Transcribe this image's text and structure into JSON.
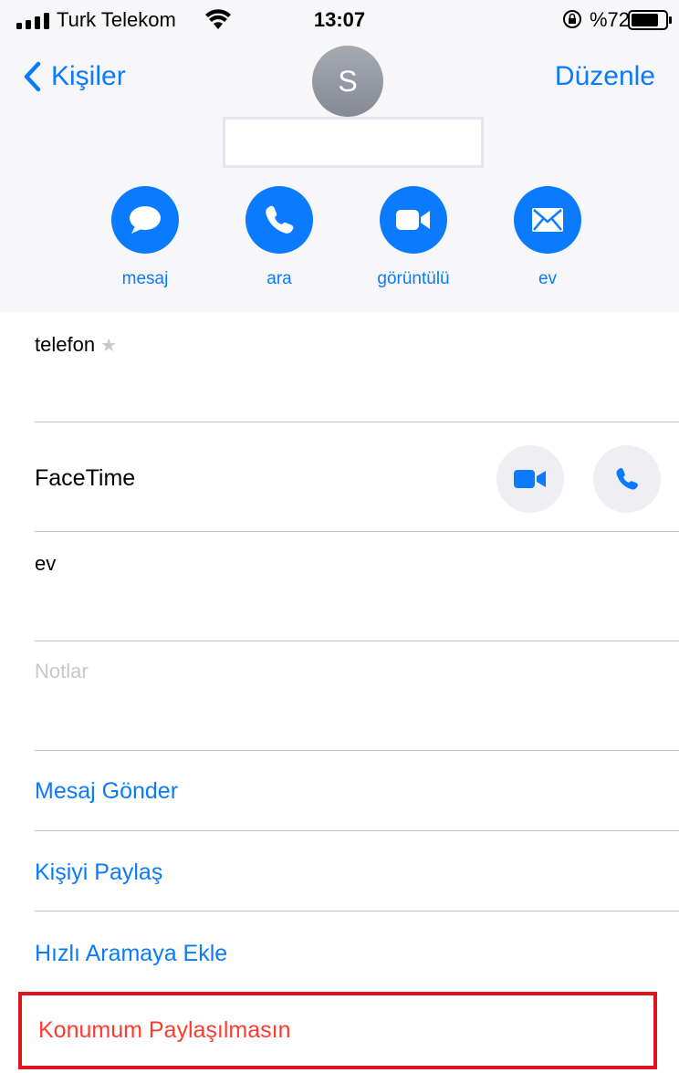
{
  "status": {
    "carrier": "Turk Telekom",
    "time": "13:07",
    "battery": "%72"
  },
  "nav": {
    "back_label": "Kişiler",
    "edit_label": "Düzenle",
    "avatar_initial": "S"
  },
  "actions": [
    {
      "label": "mesaj"
    },
    {
      "label": "ara"
    },
    {
      "label": "görüntülü"
    },
    {
      "label": "ev"
    }
  ],
  "fields": {
    "phone_label": "telefon",
    "facetime_label": "FaceTime",
    "home_label": "ev",
    "notes_placeholder": "Notlar"
  },
  "links": {
    "send_message": "Mesaj Gönder",
    "share_contact": "Kişiyi Paylaş",
    "add_favorites": "Hızlı Aramaya Ekle",
    "stop_location": "Konumum Paylaşılmasın"
  },
  "colors": {
    "accent": "#0a7aff",
    "danger": "#ff3b30",
    "highlight_border": "#e0141e"
  }
}
